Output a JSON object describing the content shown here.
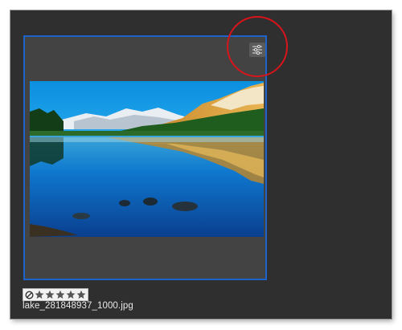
{
  "thumbnail": {
    "filename": "lake_281848937_1000.jpg",
    "rating": {
      "stars": 5,
      "filled": 5,
      "reject_icon": "no-entry-icon",
      "star_icon": "star-icon"
    },
    "settings_icon": "sliders-icon",
    "selected": true
  },
  "colors": {
    "selection_border": "#1e63c9",
    "highlight_circle": "#d8141b",
    "panel_bg": "#2f2f2f",
    "thumb_bg": "#434343"
  }
}
